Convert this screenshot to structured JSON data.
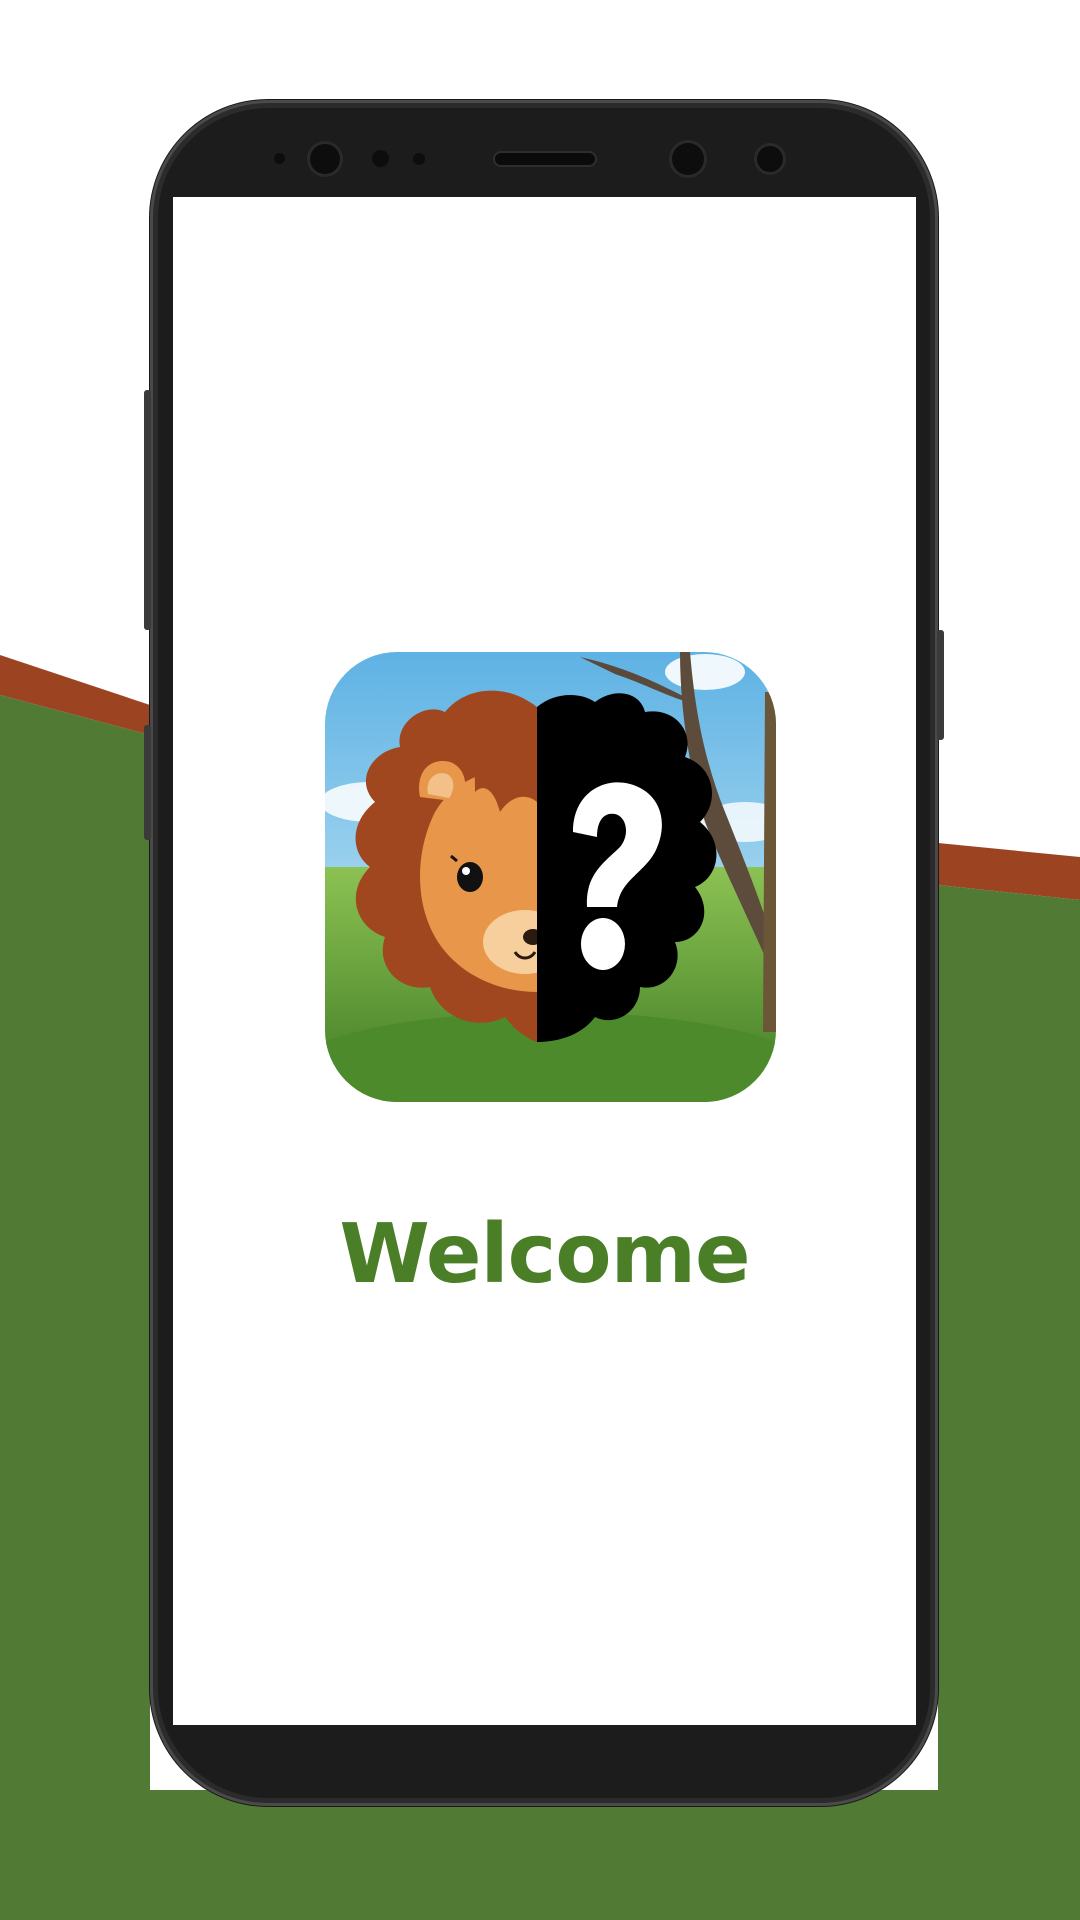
{
  "screen": {
    "welcome_text": "Welcome"
  },
  "app_icon": {
    "name": "lion-silhouette-app-icon",
    "symbol": "?"
  },
  "colors": {
    "background_green": "#517a34",
    "background_brown_stripe": "#9c4422",
    "phone_frame": "#2b2b2b",
    "welcome_green": "#4a7f28",
    "lion_mane": "#a0471f",
    "lion_face": "#e8964a",
    "sky": "#7cc3ea",
    "grass": "#6faa3c"
  }
}
